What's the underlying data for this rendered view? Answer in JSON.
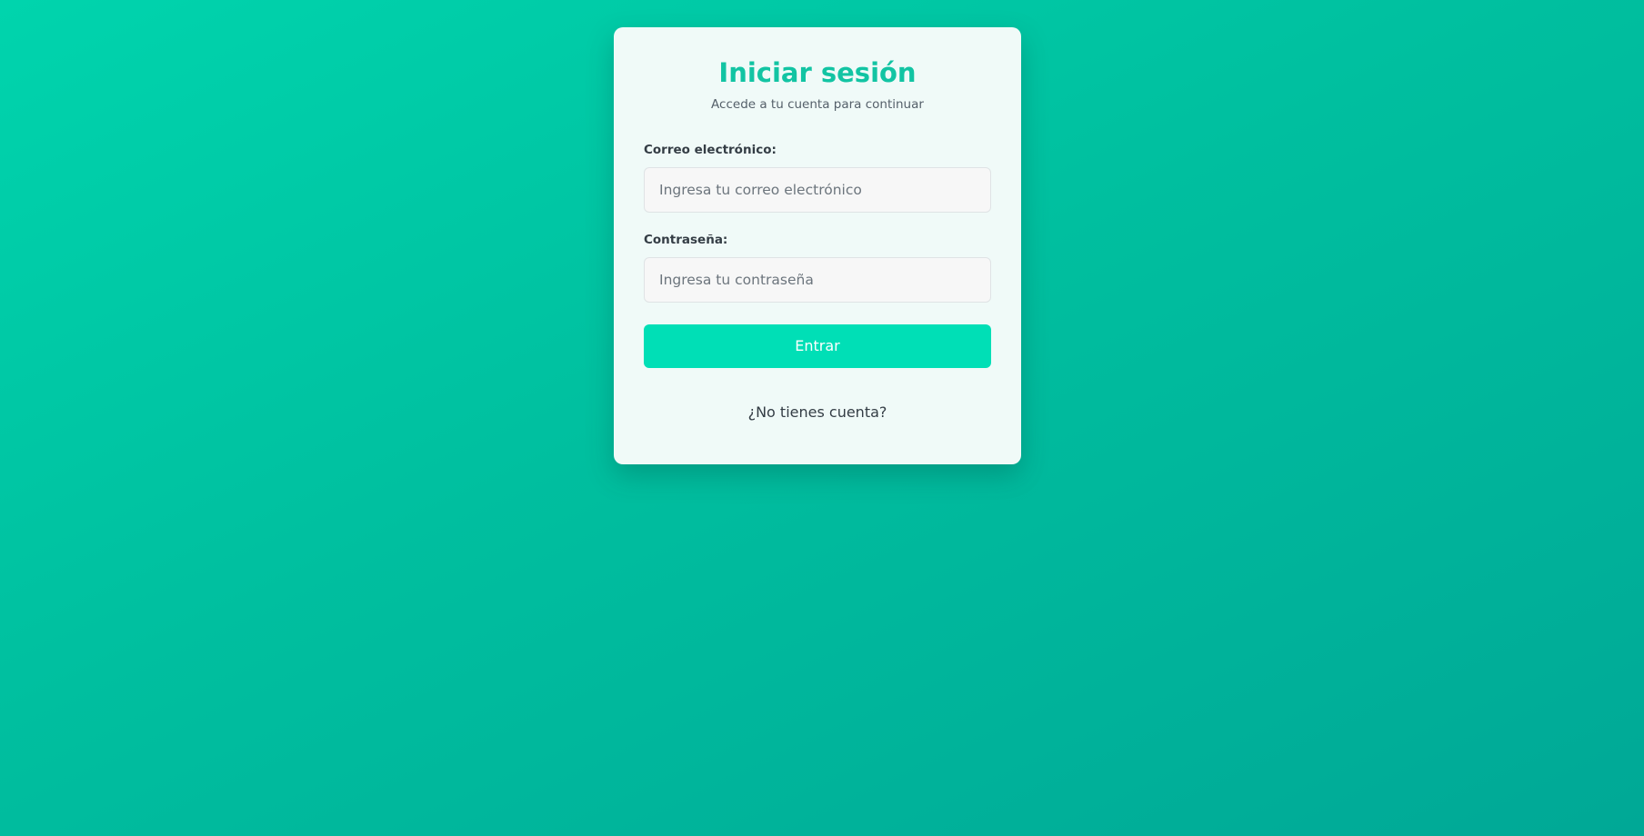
{
  "login": {
    "title": "Iniciar sesión",
    "subtitle": "Accede a tu cuenta para continuar",
    "email": {
      "label": "Correo electrónico:",
      "value": "",
      "placeholder": "Ingresa tu correo electrónico"
    },
    "password": {
      "label": "Contraseña:",
      "value": "",
      "placeholder": "Ingresa tu contraseña"
    },
    "submit_label": "Entrar",
    "signup_link": "¿No tienes cuenta?"
  },
  "colors": {
    "background_start": "#00d4ad",
    "background_end": "#00a896",
    "card": "#f0faf8",
    "title": "#12c4a3",
    "button": "#00dfb6"
  }
}
